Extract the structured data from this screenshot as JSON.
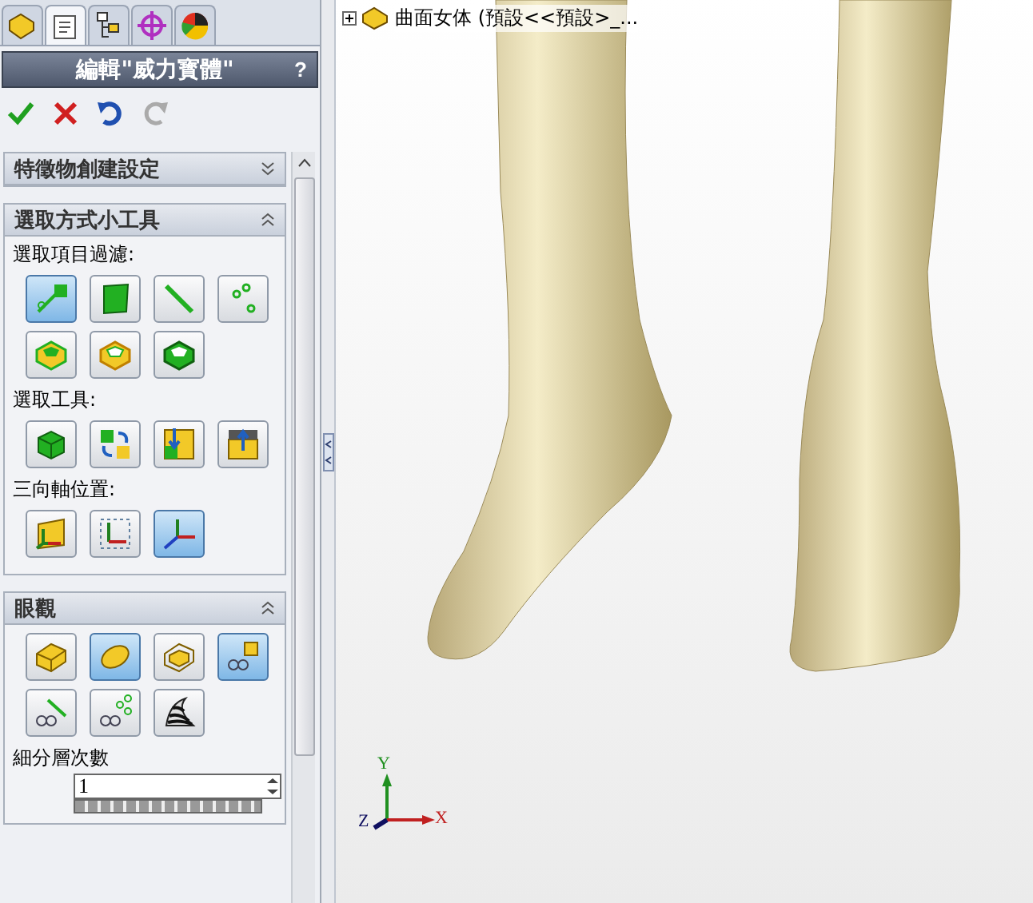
{
  "panel": {
    "tabs": [
      {
        "selected": false
      },
      {
        "selected": true
      },
      {
        "selected": false
      },
      {
        "selected": false
      },
      {
        "selected": false
      }
    ],
    "title": "編輯\"威力寳體\"",
    "help": "?",
    "sections": [
      {
        "title": "特徵物創建設定",
        "expanded": false
      },
      {
        "title": "選取方式小工具",
        "expanded": true,
        "groups": [
          {
            "label": "選取項目過濾:",
            "buttons": [
              {
                "selected": true
              },
              {
                "selected": false
              },
              {
                "selected": false
              },
              {
                "selected": false
              },
              {
                "selected": false
              },
              {
                "selected": false
              },
              {
                "selected": false
              }
            ]
          },
          {
            "label": "選取工具:",
            "buttons": [
              {
                "selected": false
              },
              {
                "selected": false
              },
              {
                "selected": false
              },
              {
                "selected": false
              }
            ]
          },
          {
            "label": "三向軸位置:",
            "buttons": [
              {
                "selected": false
              },
              {
                "selected": false
              },
              {
                "selected": true
              }
            ]
          }
        ]
      },
      {
        "title": "眼觀",
        "expanded": true,
        "groups": [
          {
            "buttons": [
              {
                "selected": false
              },
              {
                "selected": true
              },
              {
                "selected": false
              },
              {
                "selected": true
              },
              {
                "selected": false
              },
              {
                "selected": false
              },
              {
                "selected": false
              }
            ]
          }
        ],
        "field": {
          "label": "細分層次數",
          "value": "1"
        }
      }
    ]
  },
  "tree": {
    "expanded": false,
    "text": "曲面女体 (預設<<預設>_..."
  },
  "triad": {
    "x": "X",
    "y": "Y",
    "z": "Z"
  }
}
